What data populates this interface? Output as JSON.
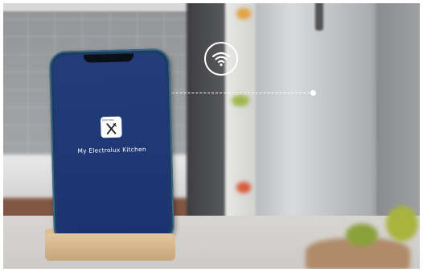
{
  "phone": {
    "app_title": "My Electrolux Kitchen",
    "app_icon_brand": "Electrolux",
    "app_icon": "fork-knife-icon"
  },
  "connection": {
    "icon": "wifi-icon",
    "line_style": "dashed"
  },
  "colors": {
    "screen": "#223d7a",
    "phone_frame": "#1d3d5e",
    "stand": "#d4b48a",
    "accent_white": "#ffffff"
  }
}
